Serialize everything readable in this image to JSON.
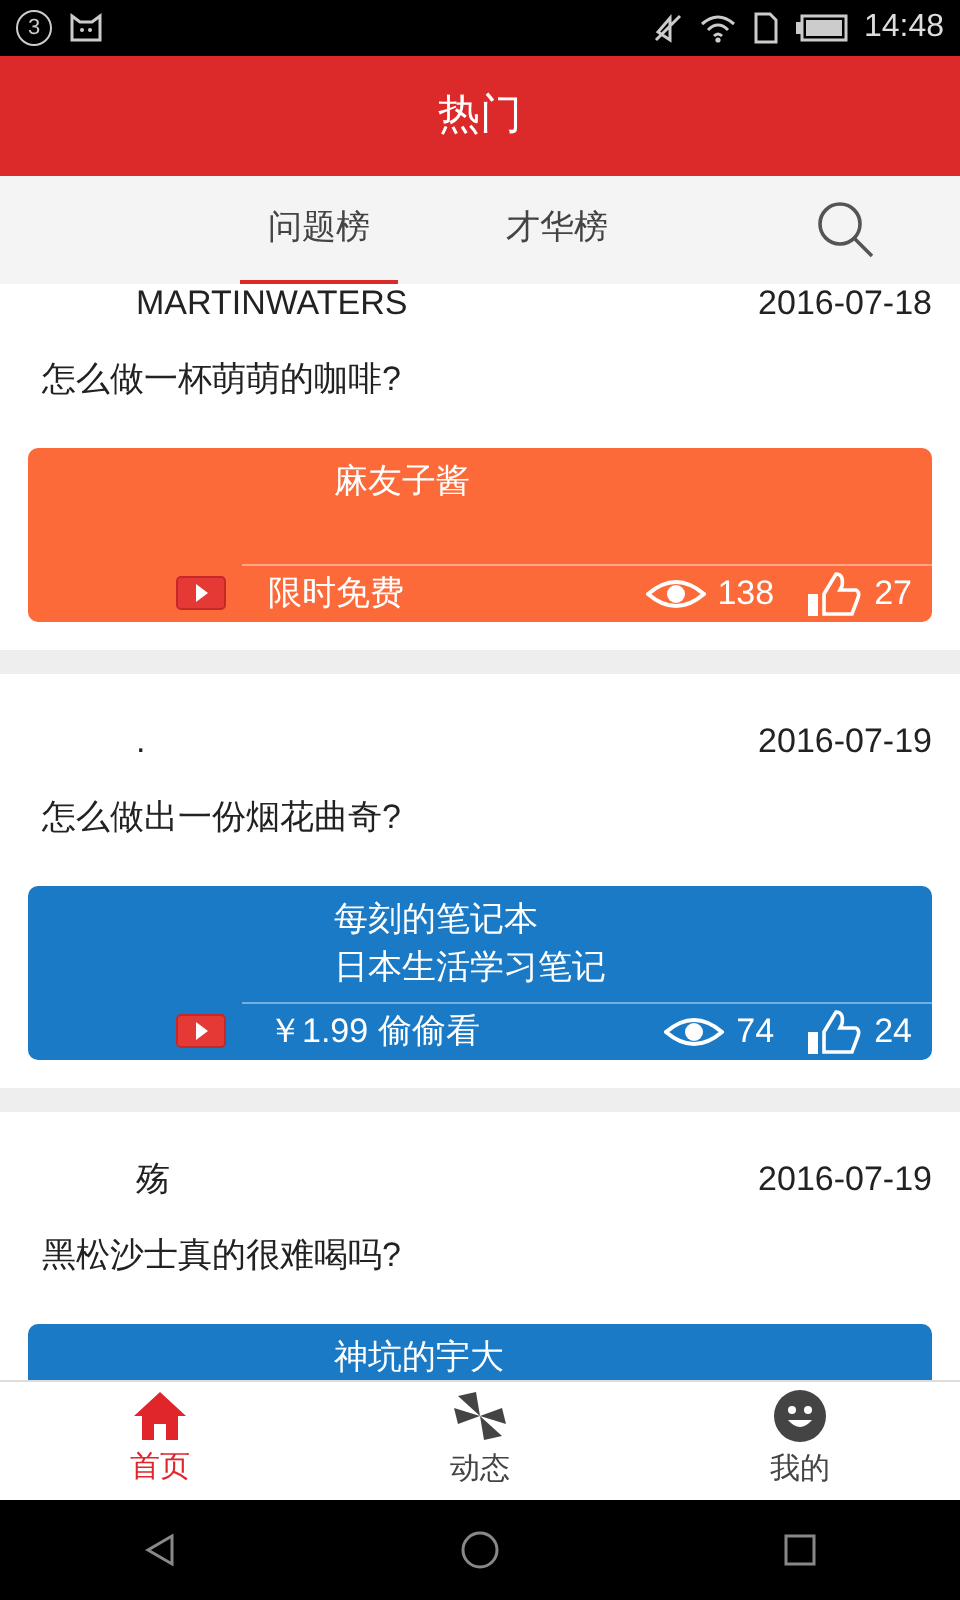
{
  "status_bar": {
    "notification_count": "3",
    "time": "14:48"
  },
  "header": {
    "title": "热门"
  },
  "tabs": [
    {
      "label": "问题榜",
      "selected": true
    },
    {
      "label": "才华榜",
      "selected": false
    }
  ],
  "posts": [
    {
      "user": "MARTINWATERS",
      "date": "2016-07-18",
      "question": "怎么做一杯萌萌的咖啡?",
      "card": {
        "color": "#fd6a3a",
        "lines": [
          "麻友子酱"
        ],
        "price": "限时免费",
        "views": "138",
        "likes": "27"
      }
    },
    {
      "user": ".",
      "date": "2016-07-19",
      "question": "怎么做出一份烟花曲奇?",
      "card": {
        "color": "#1a7ac6",
        "lines": [
          "每刻的笔记本",
          "日本生活学习笔记"
        ],
        "price": "￥1.99 偷偷看",
        "views": "74",
        "likes": "24"
      }
    },
    {
      "user": "殇",
      "date": "2016-07-19",
      "question": "黑松沙士真的很难喝吗?",
      "card": {
        "color": "#1a7ac6",
        "lines": [
          "神坑的宇大"
        ]
      }
    }
  ],
  "bottom_nav": [
    {
      "label": "首页",
      "kind": "home",
      "selected": true
    },
    {
      "label": "动态",
      "kind": "pinwheel",
      "selected": false
    },
    {
      "label": "我的",
      "kind": "smiley",
      "selected": false
    }
  ]
}
